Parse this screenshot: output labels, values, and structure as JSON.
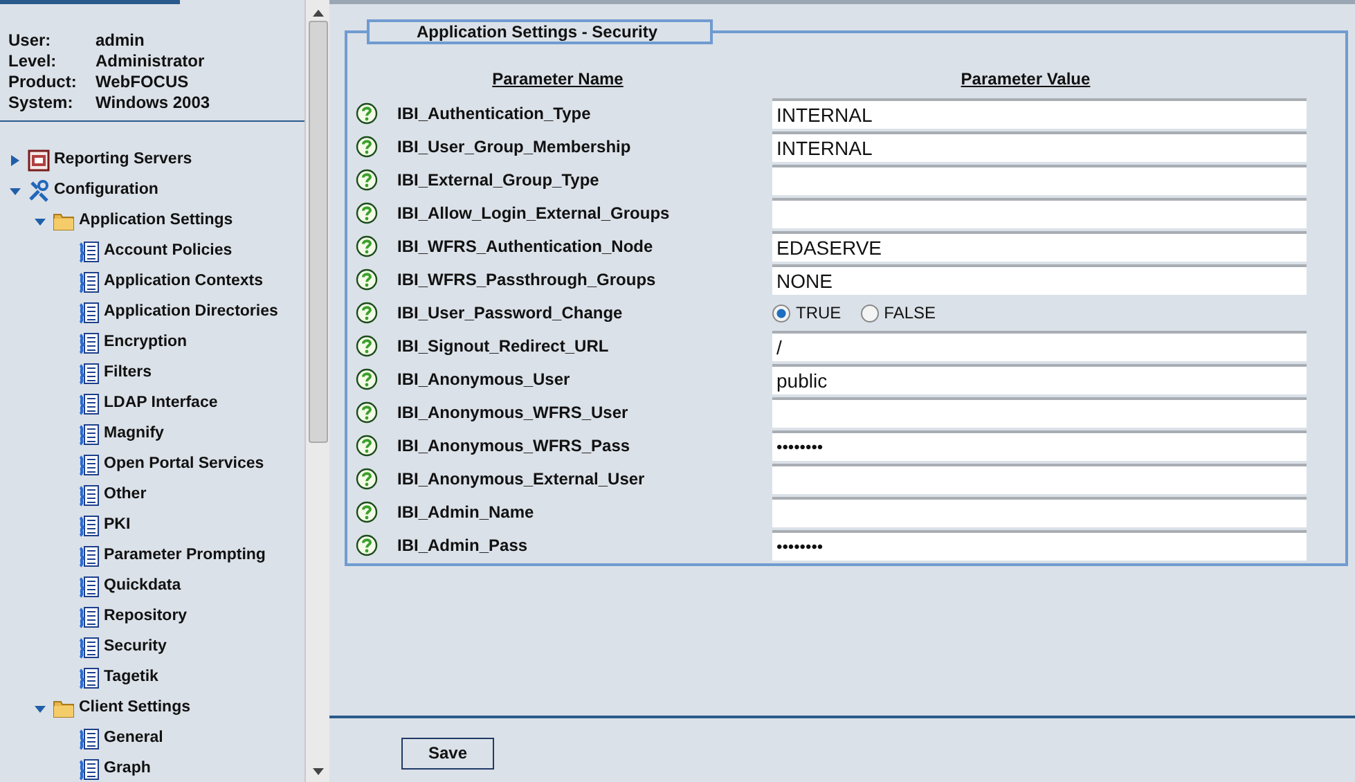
{
  "user_info": [
    {
      "label": "User:",
      "value": "admin"
    },
    {
      "label": "Level:",
      "value": "Administrator"
    },
    {
      "label": "Product:",
      "value": "WebFOCUS"
    },
    {
      "label": "System:",
      "value": "Windows 2003"
    }
  ],
  "tree": [
    {
      "label": "Reporting Servers",
      "kind": "server",
      "expanded": false
    },
    {
      "label": "Configuration",
      "kind": "tools",
      "expanded": true,
      "children": [
        {
          "label": "Application Settings",
          "kind": "folder",
          "expanded": true,
          "children": [
            {
              "label": "Account Policies",
              "kind": "page"
            },
            {
              "label": "Application Contexts",
              "kind": "page"
            },
            {
              "label": "Application Directories",
              "kind": "page"
            },
            {
              "label": "Encryption",
              "kind": "page"
            },
            {
              "label": "Filters",
              "kind": "page"
            },
            {
              "label": "LDAP Interface",
              "kind": "page"
            },
            {
              "label": "Magnify",
              "kind": "page"
            },
            {
              "label": "Open Portal Services",
              "kind": "page"
            },
            {
              "label": "Other",
              "kind": "page"
            },
            {
              "label": "PKI",
              "kind": "page"
            },
            {
              "label": "Parameter Prompting",
              "kind": "page"
            },
            {
              "label": "Quickdata",
              "kind": "page"
            },
            {
              "label": "Repository",
              "kind": "page"
            },
            {
              "label": "Security",
              "kind": "page"
            },
            {
              "label": "Tagetik",
              "kind": "page"
            }
          ]
        },
        {
          "label": "Client Settings",
          "kind": "folder",
          "expanded": true,
          "children": [
            {
              "label": "General",
              "kind": "page"
            },
            {
              "label": "Graph",
              "kind": "page"
            }
          ]
        }
      ]
    }
  ],
  "panel": {
    "title": "Application Settings - Security",
    "columns": [
      "Parameter Name",
      "Parameter Value"
    ],
    "params": [
      {
        "name": "IBI_Authentication_Type",
        "kind": "text",
        "value": "INTERNAL"
      },
      {
        "name": "IBI_User_Group_Membership",
        "kind": "text",
        "value": "INTERNAL"
      },
      {
        "name": "IBI_External_Group_Type",
        "kind": "text"
      },
      {
        "name": "IBI_Allow_Login_External_Groups",
        "kind": "text"
      },
      {
        "name": "IBI_WFRS_Authentication_Node",
        "kind": "text",
        "value": "EDASERVE"
      },
      {
        "name": "IBI_WFRS_Passthrough_Groups",
        "kind": "text",
        "value": "NONE"
      },
      {
        "name": "IBI_User_Password_Change",
        "kind": "radio",
        "options": [
          {
            "label": "TRUE",
            "selected": true
          },
          {
            "label": "FALSE",
            "selected": false
          }
        ]
      },
      {
        "name": "IBI_Signout_Redirect_URL",
        "kind": "text",
        "value": "/"
      },
      {
        "name": "IBI_Anonymous_User",
        "kind": "text",
        "value": "public"
      },
      {
        "name": "IBI_Anonymous_WFRS_User",
        "kind": "text"
      },
      {
        "name": "IBI_Anonymous_WFRS_Pass",
        "kind": "password",
        "value": "••••••••"
      },
      {
        "name": "IBI_Anonymous_External_User",
        "kind": "text"
      },
      {
        "name": "IBI_Admin_Name",
        "kind": "text"
      },
      {
        "name": "IBI_Admin_Pass",
        "kind": "password",
        "value": "••••••••"
      }
    ]
  },
  "save_button": "Save"
}
